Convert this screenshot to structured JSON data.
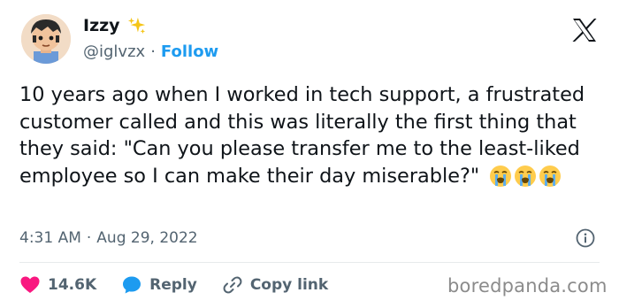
{
  "author": {
    "display_name": "Izzy",
    "handle": "@iglvzx",
    "separator": "·",
    "follow_label": "Follow"
  },
  "tweet": {
    "text": "10 years ago when I worked in tech support, a frustrated customer called and this was literally the first thing that they said: \"Can you please transfer me to the least-liked employee so I can make their day miserable?\"",
    "emojis": [
      "loudly-crying-face",
      "loudly-crying-face",
      "loudly-crying-face"
    ],
    "time": "4:31 AM",
    "separator": "·",
    "date": "Aug 29, 2022"
  },
  "actions": {
    "like_count": "14.6K",
    "reply_label": "Reply",
    "copy_link_label": "Copy link"
  },
  "watermark": "boredpanda.com",
  "colors": {
    "accent": "#1d9bf0",
    "like": "#f91880",
    "text": "#0f1419",
    "muted": "#536471"
  },
  "icons": {
    "brand": "x-logo",
    "badge": "sparkles-icon",
    "info": "info-icon",
    "like": "heart-icon",
    "reply": "speech-bubble-icon",
    "copy": "link-icon"
  }
}
